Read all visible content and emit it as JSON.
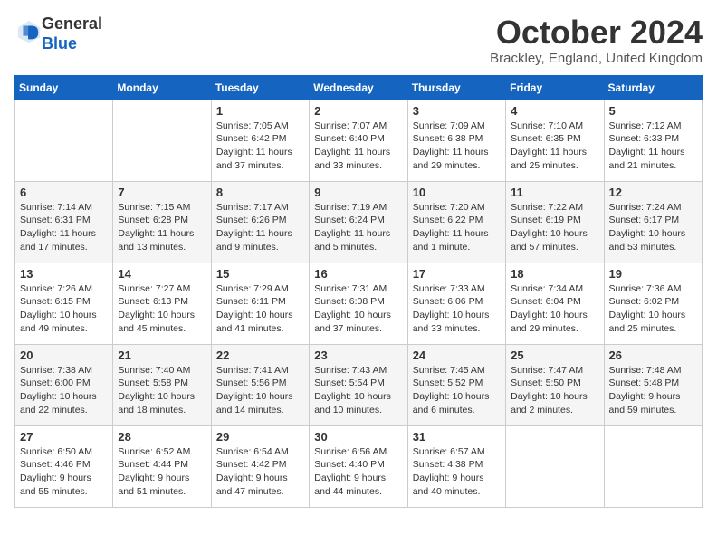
{
  "header": {
    "logo_line1": "General",
    "logo_line2": "Blue",
    "month_title": "October 2024",
    "location": "Brackley, England, United Kingdom"
  },
  "days_of_week": [
    "Sunday",
    "Monday",
    "Tuesday",
    "Wednesday",
    "Thursday",
    "Friday",
    "Saturday"
  ],
  "weeks": [
    [
      {
        "day": "",
        "info": ""
      },
      {
        "day": "",
        "info": ""
      },
      {
        "day": "1",
        "info": "Sunrise: 7:05 AM\nSunset: 6:42 PM\nDaylight: 11 hours and 37 minutes."
      },
      {
        "day": "2",
        "info": "Sunrise: 7:07 AM\nSunset: 6:40 PM\nDaylight: 11 hours and 33 minutes."
      },
      {
        "day": "3",
        "info": "Sunrise: 7:09 AM\nSunset: 6:38 PM\nDaylight: 11 hours and 29 minutes."
      },
      {
        "day": "4",
        "info": "Sunrise: 7:10 AM\nSunset: 6:35 PM\nDaylight: 11 hours and 25 minutes."
      },
      {
        "day": "5",
        "info": "Sunrise: 7:12 AM\nSunset: 6:33 PM\nDaylight: 11 hours and 21 minutes."
      }
    ],
    [
      {
        "day": "6",
        "info": "Sunrise: 7:14 AM\nSunset: 6:31 PM\nDaylight: 11 hours and 17 minutes."
      },
      {
        "day": "7",
        "info": "Sunrise: 7:15 AM\nSunset: 6:28 PM\nDaylight: 11 hours and 13 minutes."
      },
      {
        "day": "8",
        "info": "Sunrise: 7:17 AM\nSunset: 6:26 PM\nDaylight: 11 hours and 9 minutes."
      },
      {
        "day": "9",
        "info": "Sunrise: 7:19 AM\nSunset: 6:24 PM\nDaylight: 11 hours and 5 minutes."
      },
      {
        "day": "10",
        "info": "Sunrise: 7:20 AM\nSunset: 6:22 PM\nDaylight: 11 hours and 1 minute."
      },
      {
        "day": "11",
        "info": "Sunrise: 7:22 AM\nSunset: 6:19 PM\nDaylight: 10 hours and 57 minutes."
      },
      {
        "day": "12",
        "info": "Sunrise: 7:24 AM\nSunset: 6:17 PM\nDaylight: 10 hours and 53 minutes."
      }
    ],
    [
      {
        "day": "13",
        "info": "Sunrise: 7:26 AM\nSunset: 6:15 PM\nDaylight: 10 hours and 49 minutes."
      },
      {
        "day": "14",
        "info": "Sunrise: 7:27 AM\nSunset: 6:13 PM\nDaylight: 10 hours and 45 minutes."
      },
      {
        "day": "15",
        "info": "Sunrise: 7:29 AM\nSunset: 6:11 PM\nDaylight: 10 hours and 41 minutes."
      },
      {
        "day": "16",
        "info": "Sunrise: 7:31 AM\nSunset: 6:08 PM\nDaylight: 10 hours and 37 minutes."
      },
      {
        "day": "17",
        "info": "Sunrise: 7:33 AM\nSunset: 6:06 PM\nDaylight: 10 hours and 33 minutes."
      },
      {
        "day": "18",
        "info": "Sunrise: 7:34 AM\nSunset: 6:04 PM\nDaylight: 10 hours and 29 minutes."
      },
      {
        "day": "19",
        "info": "Sunrise: 7:36 AM\nSunset: 6:02 PM\nDaylight: 10 hours and 25 minutes."
      }
    ],
    [
      {
        "day": "20",
        "info": "Sunrise: 7:38 AM\nSunset: 6:00 PM\nDaylight: 10 hours and 22 minutes."
      },
      {
        "day": "21",
        "info": "Sunrise: 7:40 AM\nSunset: 5:58 PM\nDaylight: 10 hours and 18 minutes."
      },
      {
        "day": "22",
        "info": "Sunrise: 7:41 AM\nSunset: 5:56 PM\nDaylight: 10 hours and 14 minutes."
      },
      {
        "day": "23",
        "info": "Sunrise: 7:43 AM\nSunset: 5:54 PM\nDaylight: 10 hours and 10 minutes."
      },
      {
        "day": "24",
        "info": "Sunrise: 7:45 AM\nSunset: 5:52 PM\nDaylight: 10 hours and 6 minutes."
      },
      {
        "day": "25",
        "info": "Sunrise: 7:47 AM\nSunset: 5:50 PM\nDaylight: 10 hours and 2 minutes."
      },
      {
        "day": "26",
        "info": "Sunrise: 7:48 AM\nSunset: 5:48 PM\nDaylight: 9 hours and 59 minutes."
      }
    ],
    [
      {
        "day": "27",
        "info": "Sunrise: 6:50 AM\nSunset: 4:46 PM\nDaylight: 9 hours and 55 minutes."
      },
      {
        "day": "28",
        "info": "Sunrise: 6:52 AM\nSunset: 4:44 PM\nDaylight: 9 hours and 51 minutes."
      },
      {
        "day": "29",
        "info": "Sunrise: 6:54 AM\nSunset: 4:42 PM\nDaylight: 9 hours and 47 minutes."
      },
      {
        "day": "30",
        "info": "Sunrise: 6:56 AM\nSunset: 4:40 PM\nDaylight: 9 hours and 44 minutes."
      },
      {
        "day": "31",
        "info": "Sunrise: 6:57 AM\nSunset: 4:38 PM\nDaylight: 9 hours and 40 minutes."
      },
      {
        "day": "",
        "info": ""
      },
      {
        "day": "",
        "info": ""
      }
    ]
  ]
}
